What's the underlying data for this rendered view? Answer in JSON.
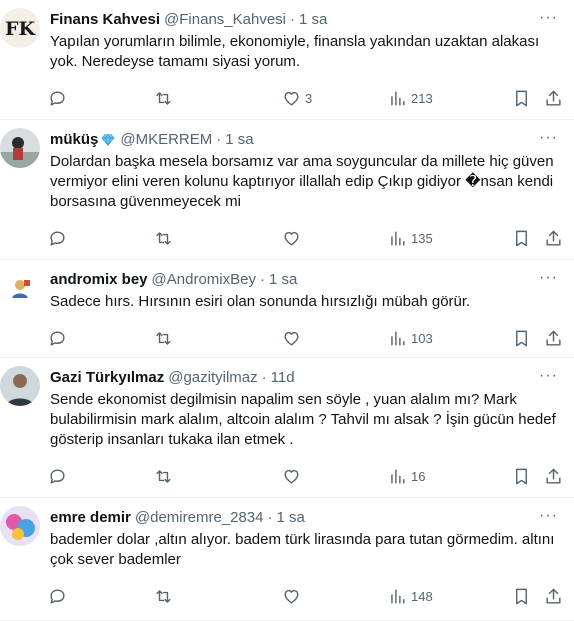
{
  "tweets": [
    {
      "name": "Finans Kahvesi",
      "handle": "@Finans_Kahvesi",
      "time": "1 sa",
      "text": "Yapılan yorumların bilimle, ekonomiyle, finansla yakından uzaktan alakası yok. Neredeyse tamamı siyasi yorum.",
      "avatar_text": "FK",
      "likes": "3",
      "views": "213"
    },
    {
      "name": "müküş",
      "handle": "@MKERREM",
      "time": "1 sa",
      "text": "Dolardan başka mesela borsamız var ama soyguncular da millete hiç güven vermiyor elini veren kolunu kaptırıyor illallah edip Çıkıp gidiyor �nsan kendi borsasına güvenmeyecek mi",
      "likes": "",
      "views": "135"
    },
    {
      "name": "andromix bey",
      "handle": "@AndromixBey",
      "time": "1 sa",
      "text": "Sadece hırs. Hırsının esiri olan sonunda hırsızlığı mübah görür.",
      "likes": "",
      "views": "103"
    },
    {
      "name": "Gazi Türkyılmaz",
      "handle": "@gazityilmaz",
      "time": "11d",
      "text": "Sende ekonomist degilmisin napalim sen söyle , yuan alalım mı? Mark bulabilirmisin mark alalım, altcoin alalım ? Tahvil mı alsak ? İşin gücün hedef gösterip insanları tukaka ilan etmek .",
      "likes": "",
      "views": "16"
    },
    {
      "name": "emre demir",
      "handle": "@demiremre_2834",
      "time": "1 sa",
      "text": "bademler dolar ,altın alıyor. badem türk lirasında para tutan görmedim. altını çok sever bademler",
      "likes": "",
      "views": "148"
    }
  ],
  "separator": "·",
  "more_label": "···",
  "icons": [
    "reply-icon",
    "retweet-icon",
    "like-icon",
    "views-icon",
    "bookmark-icon",
    "share-icon"
  ],
  "colors": {
    "text": "#0f1419",
    "muted": "#536471",
    "border": "#eff3f4"
  }
}
